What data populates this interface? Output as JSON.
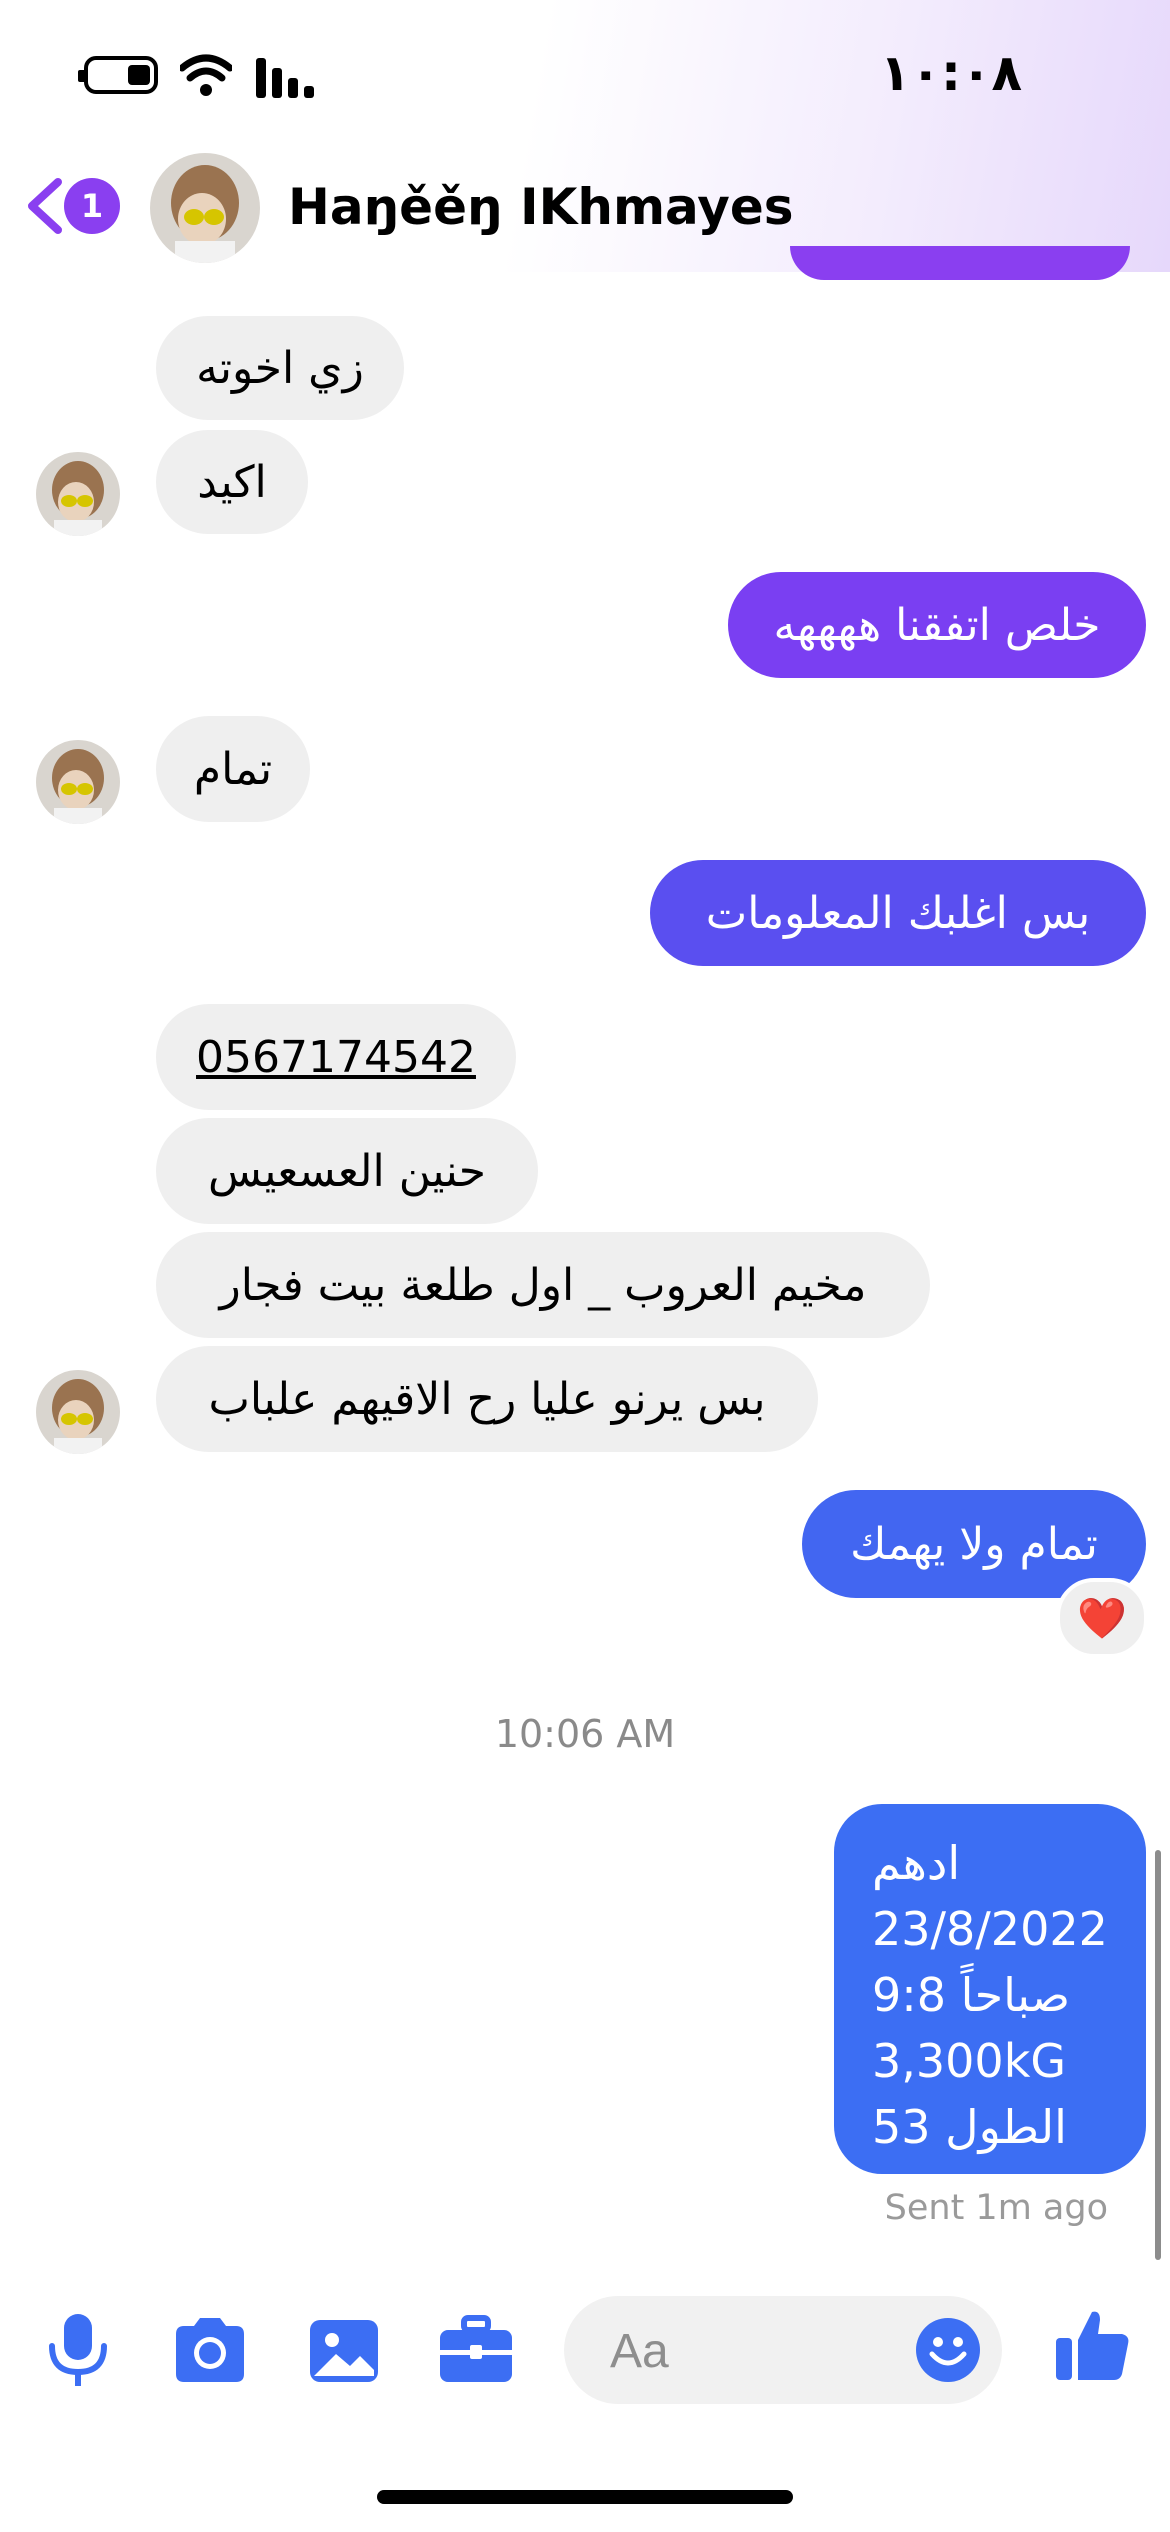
{
  "status_bar": {
    "time": "١٠:٠٨"
  },
  "header": {
    "unread_count": "1",
    "contact_name": "Haŋěěŋ IKhmayes"
  },
  "messages": {
    "m1": "زي اخوته",
    "m2": "اكيد",
    "m3": "خلص اتفقنا ههههه",
    "m4": "تمام",
    "m5": "بس اغلبك المعلومات",
    "m6": "0567174542",
    "m7": "حنين العسعيس",
    "m8": "مخيم العروب _ اول طلعة بيت فجار",
    "m9": "بس يرنو عليا رح الاقيهم علباب",
    "m10": "تمام ولا يهمك",
    "reaction": "❤️",
    "time_divider": "10:06 AM",
    "multiline": {
      "line1": "ادهم",
      "line2": "23/8/2022",
      "line3": "9:8 صباحاً",
      "line4": "3,300kG",
      "line5": "الطول 53"
    },
    "sent_status": "Sent 1m ago"
  },
  "composer": {
    "placeholder": "Aa"
  },
  "colors": {
    "accent_purple": "#8a3ff0",
    "accent_blue": "#3c6ef3",
    "incoming_bubble": "#efefef",
    "composer_icon": "#3c6ef3"
  }
}
